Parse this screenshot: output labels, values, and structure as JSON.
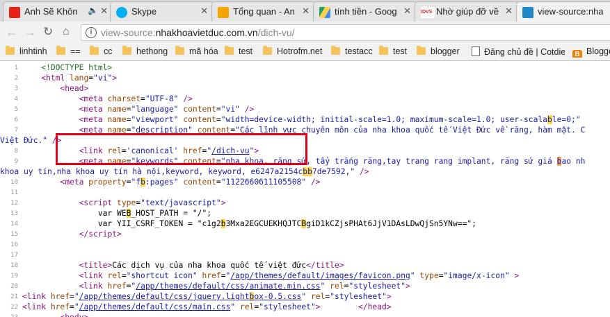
{
  "tabs": [
    {
      "title": "Anh Sẽ Khôn",
      "favicon": "youtube-icon",
      "color": "#e62117",
      "mute": "🔈"
    },
    {
      "title": "Skype",
      "favicon": "skype-icon",
      "color": "#00aff0"
    },
    {
      "title": "Tổng quan - An",
      "favicon": "analytics-icon",
      "color": "#f4a400"
    },
    {
      "title": "tính tiền - Goog",
      "favicon": "drive-icon",
      "color": "#1fa463"
    },
    {
      "title": "Nhờ giúp đỡ về",
      "favicon": "idvs-icon",
      "color": "#d42b2b",
      "badge": "IDVS"
    },
    {
      "title": "view-source:nha",
      "favicon": "site-icon",
      "color": "#1e88c8"
    }
  ],
  "url": {
    "scheme": "view-source:",
    "host": "nhakhoavietduc.com.vn",
    "path": "/dich-vu/"
  },
  "bookmarks": [
    {
      "label": "linhtinh",
      "kind": "folder"
    },
    {
      "label": "==",
      "kind": "folder"
    },
    {
      "label": "cc",
      "kind": "folder"
    },
    {
      "label": "hethong",
      "kind": "folder"
    },
    {
      "label": "mã hóa",
      "kind": "folder"
    },
    {
      "label": "test",
      "kind": "folder"
    },
    {
      "label": "Hotrofm.net",
      "kind": "folder"
    },
    {
      "label": "testacc",
      "kind": "folder"
    },
    {
      "label": "test",
      "kind": "folder"
    },
    {
      "label": "blogger",
      "kind": "folder"
    },
    {
      "label": "Đăng chủ đề | Cotdien",
      "kind": "page"
    },
    {
      "label": "Blogger",
      "kind": "blogger"
    }
  ],
  "line_numbers": [
    "1",
    "2",
    "3",
    "4",
    "5",
    "6",
    "7",
    "",
    "8",
    "9",
    "",
    "10",
    "11",
    "12",
    "13",
    "14",
    "15",
    "16",
    "17",
    "18",
    "19",
    "20",
    "21",
    "22",
    "23"
  ],
  "source": {
    "l1": "<!DOCTYPE html>",
    "l2_tag": "html",
    "l2_attr": "lang",
    "l2_val": "\"vi\"",
    "l3": "head",
    "l4_attr": "charset",
    "l4_val": "\"UTF-8\"",
    "l5_attr1": "name",
    "l5_val1": "\"language\"",
    "l5_attr2": "content",
    "l5_val2": "\"vi\"",
    "l6_attr1": "name",
    "l6_val1": "\"viewport\"",
    "l6_attr2": "content",
    "l6_val2a": "\"width=device-width; initial-scale=1.0; maximum-scale=1.0; user-scala",
    "l6_hl": "b",
    "l6_val2b": "le=0;\"",
    "l7_attr1": "name",
    "l7_val1": "\"description\"",
    "l7_attr2": "content",
    "l7_val2": "\"Các lĩnh vực chuyên môn của nha khoa quốc tế Việt Đức về răng, hàm mặt. C",
    "l7_cont": "Việt Đức.\"",
    "l8_attr1": "rel",
    "l8_val1": "'canonical'",
    "l8_attr2": "href",
    "l8_val2": "\"/dich-vu\"",
    "l9_attr1": "name",
    "l9_val1": "\"keywords\"",
    "l9_attr2": "content",
    "l9_val2a": "\"nha khoa, răng sứ, tẩy trắng răng,tay trang rang implant, răng sứ giá ",
    "l9_hl": "b",
    "l9_val2b": "ao nh",
    "l9_cont_a": "khoa uy tín,nha khoa uy tín hà nội,keyword, keyword, e6247a2154c",
    "l9_cont_hl": "bb",
    "l9_cont_b": "7de7592,\"",
    "l10_attr1": "property",
    "l10_val1a": "\"f",
    "l10_hl": "b",
    "l10_val1b": ":pages\"",
    "l10_attr2": "content",
    "l10_val2": "\"1122660611105508\"",
    "l12_attr": "type",
    "l12_val": "\"text/javascript\"",
    "l13_a": "var WE",
    "l13_hl": "B",
    "l13_b": "_HOST_PATH = \"/\";",
    "l14_a": "var YII_CSRF_TOKEN = \"c1g2",
    "l14_hl1": "b",
    "l14_b": "3Mxa2EGCUEKHQJTC",
    "l14_hl2": "B",
    "l14_c": "giD1kCZjsPHAt6JjV1DAsLDwQjSn5YNw==\";",
    "l15": "script",
    "l18_text": "Các dịch vụ của nha khoa quốc tế việt đức",
    "l19_val1": "\"shortcut icon\"",
    "l19_href": "/app/themes/default/images/favicon.png",
    "l19_type": "\"image/x-icon\"",
    "l20_href": "/app/themes/default/css/animate.min.css",
    "l20_rel": "\"stylesheet\"",
    "l21_href_a": "/app/themes/default/css/jquery.light",
    "l21_hl": "b",
    "l21_href_b": "ox-0.5.css",
    "l21_rel": "\"stylesheet\"",
    "l22_href": "/app/themes/default/css/main.css",
    "l22_rel": "\"stylesheet\"",
    "l22_close": "/head",
    "l23": "body"
  }
}
